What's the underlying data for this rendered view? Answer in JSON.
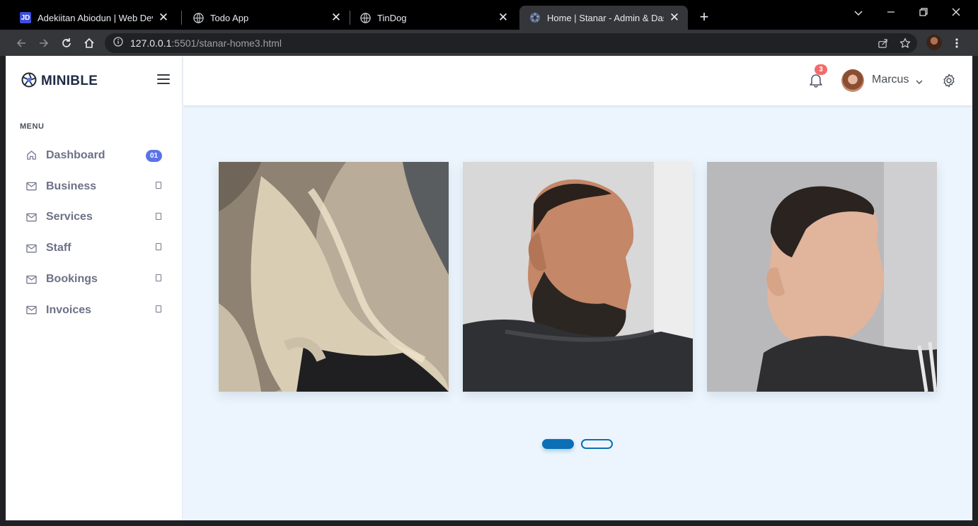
{
  "browser": {
    "tabs": [
      {
        "title": "Adekiitan Abiodun | Web Developer",
        "favicon": "JD",
        "active": false
      },
      {
        "title": "Todo App",
        "favicon": "globe-icon",
        "active": false
      },
      {
        "title": "TinDog",
        "favicon": "globe-icon",
        "active": false
      },
      {
        "title": "Home | Stanar - Admin & Dashboard",
        "favicon": "aperture-icon",
        "active": true
      }
    ],
    "url_host": "127.0.0.1",
    "url_path": ":5501/stanar-home3.html"
  },
  "sidebar": {
    "brand": "MINIBLE",
    "menu_title": "MENU",
    "items": [
      {
        "label": "Dashboard",
        "icon": "home-icon",
        "badge": "01"
      },
      {
        "label": "Business",
        "icon": "mail-icon"
      },
      {
        "label": "Services",
        "icon": "mail-icon"
      },
      {
        "label": "Staff",
        "icon": "mail-icon"
      },
      {
        "label": "Bookings",
        "icon": "mail-icon"
      },
      {
        "label": "Invoices",
        "icon": "mail-icon"
      }
    ]
  },
  "topbar": {
    "notification_count": "3",
    "user_name": "Marcus"
  },
  "carousel": {
    "slides": [
      "balayage-hair-photo",
      "beard-fade-photo",
      "crop-fade-photo"
    ],
    "active_dot": 1,
    "dot_count": 2
  },
  "colors": {
    "accent": "#0b6fb5",
    "badge": "#5b73e8",
    "notification": "#f46a6a",
    "page_bg": "#ecf5fd"
  }
}
